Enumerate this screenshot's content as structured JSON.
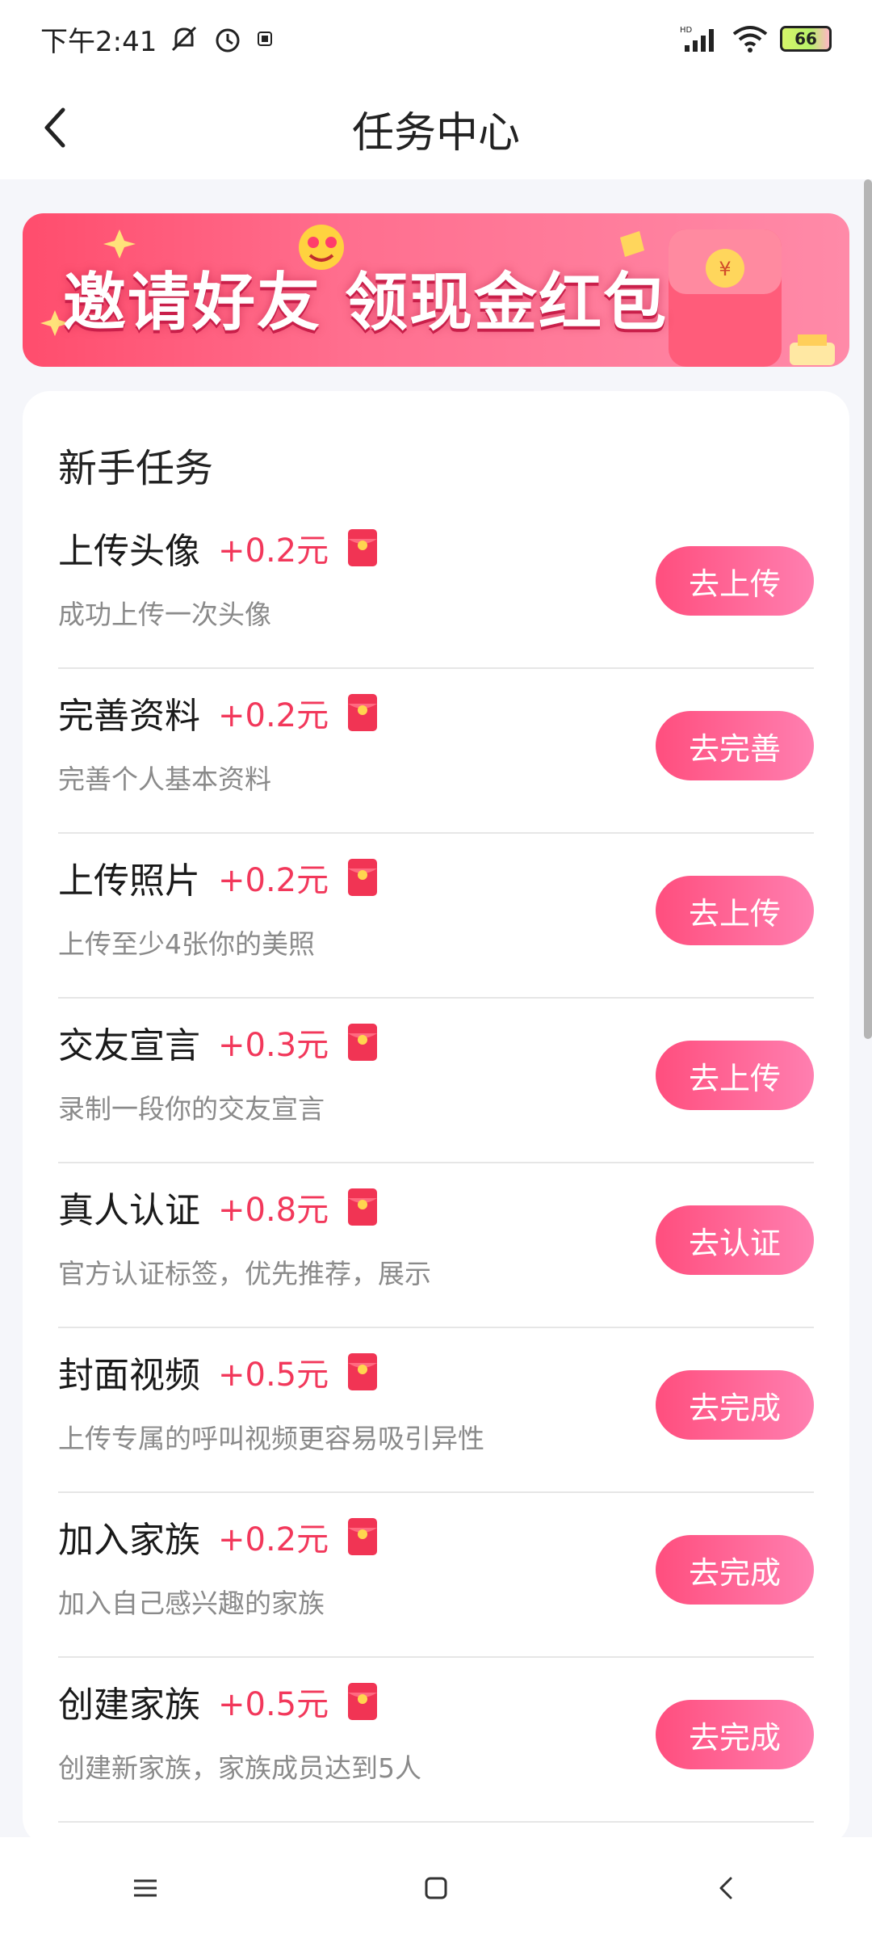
{
  "status_bar": {
    "time": "下午2:41",
    "battery": "66",
    "icons": [
      "mute-icon",
      "alarm-icon",
      "notification-icon",
      "hd-signal-icon",
      "wifi-icon",
      "battery-icon"
    ]
  },
  "header": {
    "title": "任务中心",
    "back_icon": "chevron-left-icon"
  },
  "banner": {
    "text": "邀请好友 领现金红包"
  },
  "section": {
    "title": "新手任务"
  },
  "tasks": [
    {
      "name": "上传头像",
      "reward": "+0.2元",
      "desc": "成功上传一次头像",
      "button": "去上传"
    },
    {
      "name": "完善资料",
      "reward": "+0.2元",
      "desc": "完善个人基本资料",
      "button": "去完善"
    },
    {
      "name": "上传照片",
      "reward": "+0.2元",
      "desc": "上传至少4张你的美照",
      "button": "去上传"
    },
    {
      "name": "交友宣言",
      "reward": "+0.3元",
      "desc": "录制一段你的交友宣言",
      "button": "去上传"
    },
    {
      "name": "真人认证",
      "reward": "+0.8元",
      "desc": "官方认证标签，优先推荐，展示",
      "button": "去认证"
    },
    {
      "name": "封面视频",
      "reward": "+0.5元",
      "desc": "上传专属的呼叫视频更容易吸引异性",
      "button": "去完成"
    },
    {
      "name": "加入家族",
      "reward": "+0.2元",
      "desc": "加入自己感兴趣的家族",
      "button": "去完成"
    },
    {
      "name": "创建家族",
      "reward": "+0.5元",
      "desc": "创建新家族，家族成员达到5人",
      "button": "去完成"
    }
  ],
  "colors": {
    "accent": "#f2385b",
    "button_start": "#ff4e7e",
    "button_end": "#ff7fb0"
  },
  "nav": {
    "icons": [
      "menu-icon",
      "home-icon",
      "back-icon"
    ]
  }
}
